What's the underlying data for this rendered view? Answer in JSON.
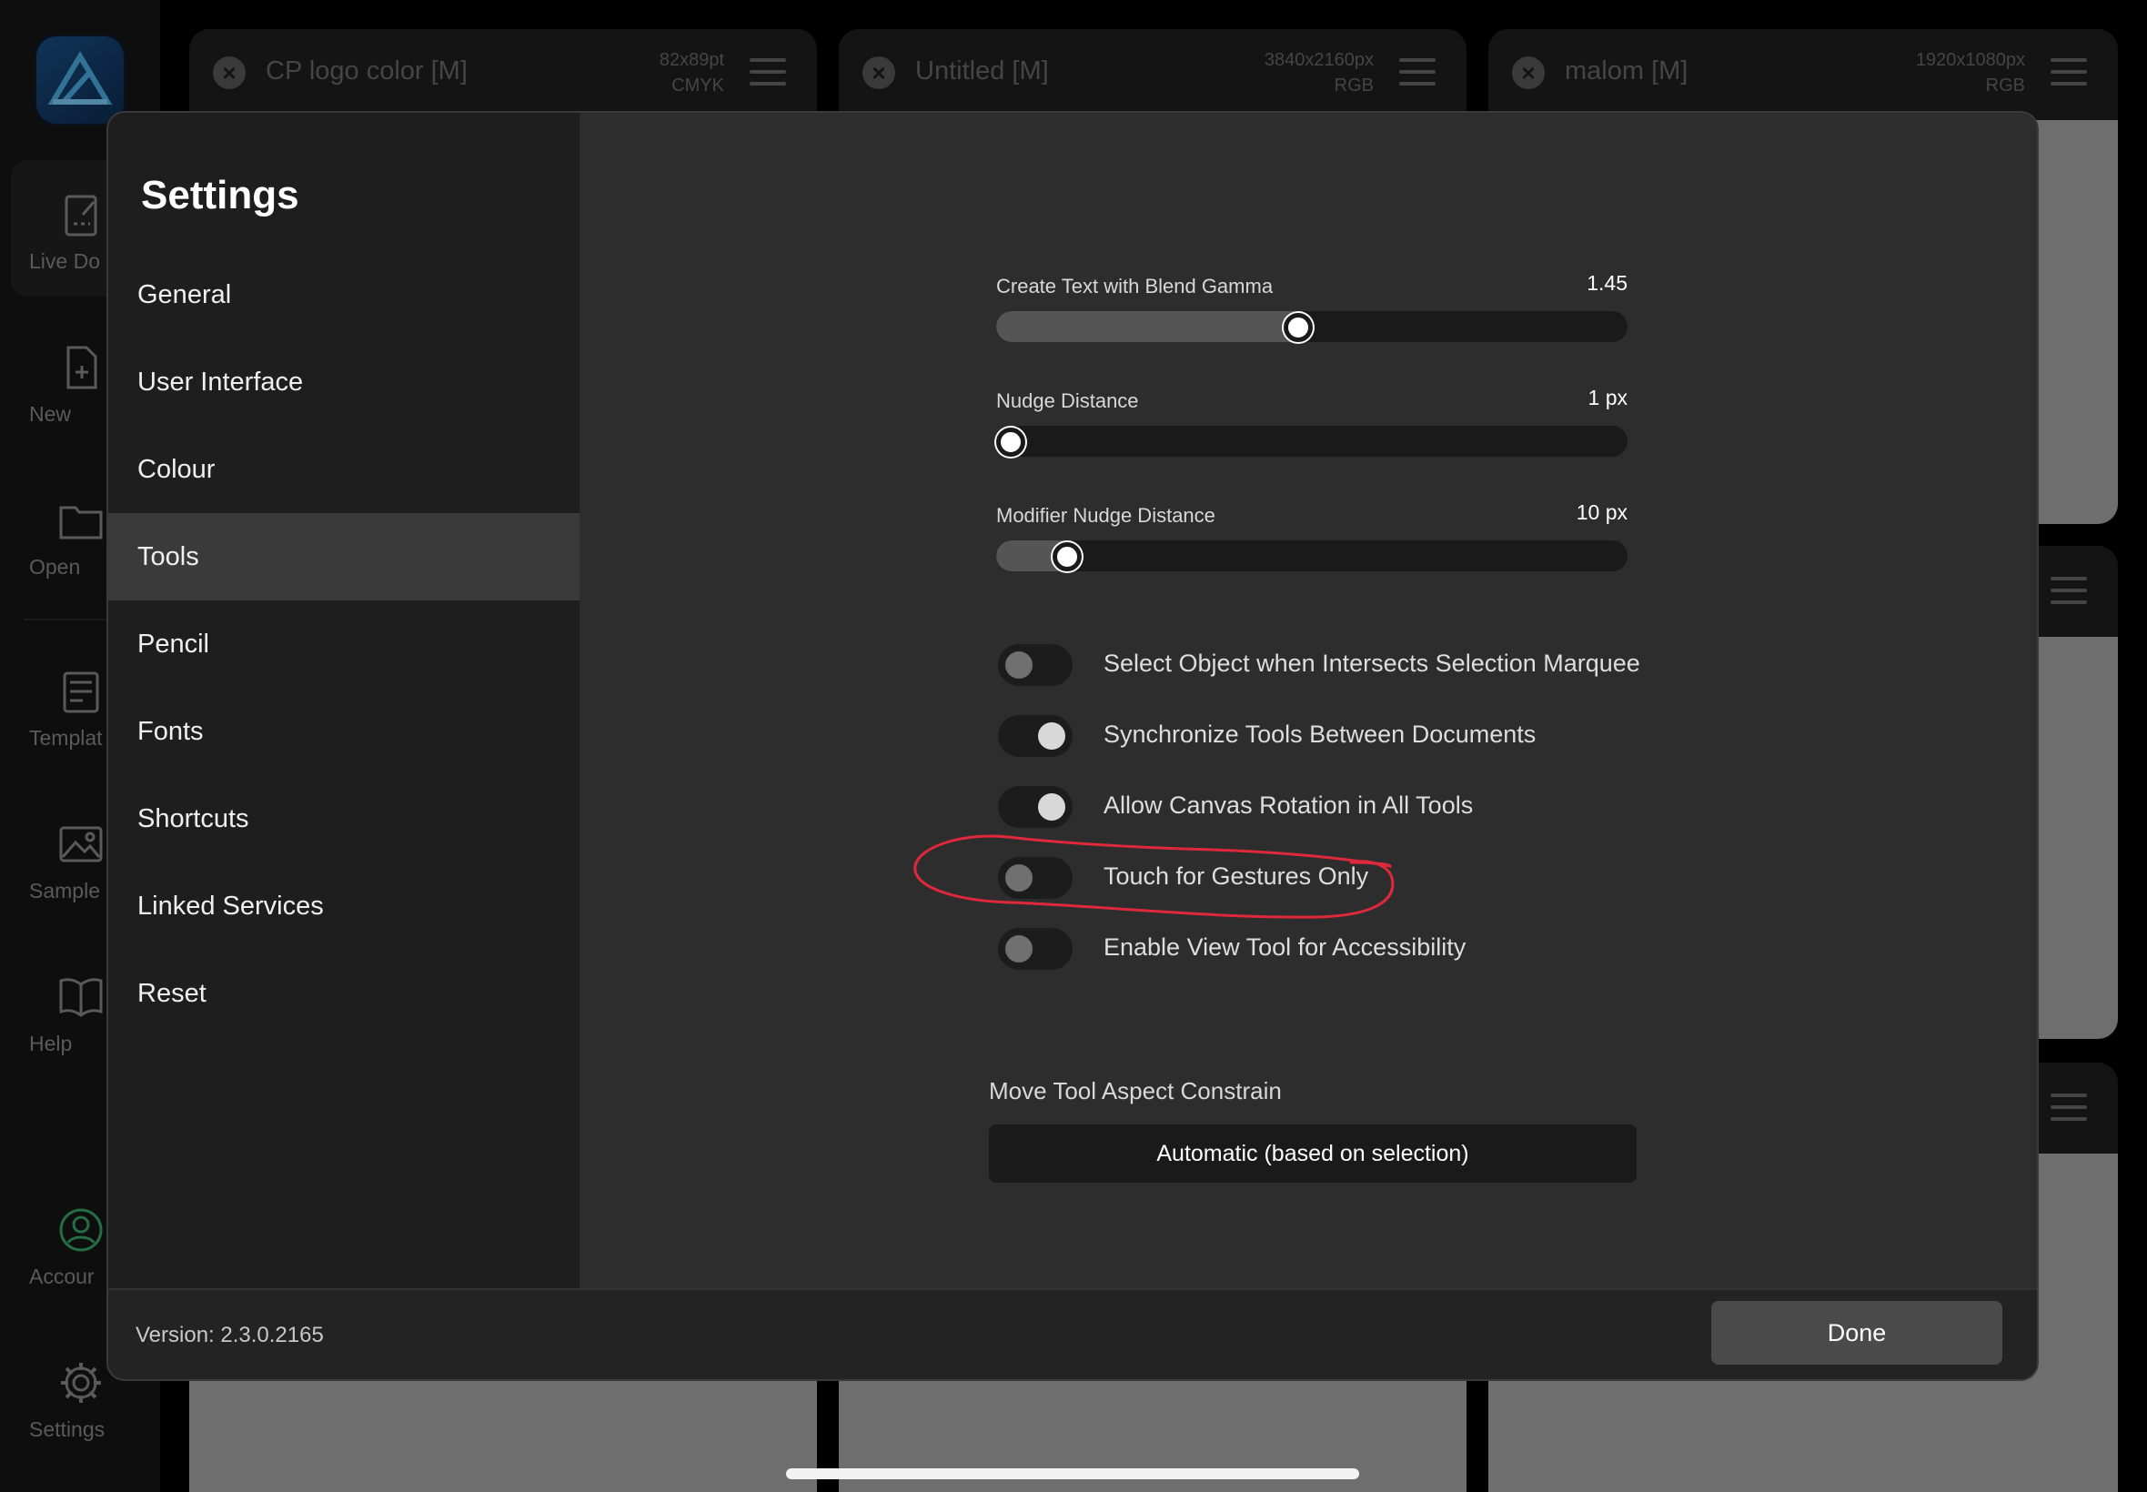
{
  "app_sidebar": {
    "items": [
      {
        "label": "Live Do",
        "icon": "live-document-icon"
      },
      {
        "label": "New",
        "icon": "new-document-icon"
      },
      {
        "label": "Open",
        "icon": "folder-icon"
      },
      {
        "label": "Templat",
        "icon": "template-icon"
      },
      {
        "label": "Sample",
        "icon": "image-icon"
      },
      {
        "label": "Help",
        "icon": "book-icon"
      },
      {
        "label": "Accour",
        "icon": "account-icon"
      },
      {
        "label": "Settings",
        "icon": "gear-icon"
      }
    ]
  },
  "documents": [
    {
      "title": "CP logo color [M]",
      "size": "82x89pt",
      "mode": "CMYK"
    },
    {
      "title": "Untitled [M]",
      "size": "3840x2160px",
      "mode": "RGB"
    },
    {
      "title": "malom [M]",
      "size": "1920x1080px",
      "mode": "RGB"
    }
  ],
  "settings": {
    "title": "Settings",
    "nav": [
      "General",
      "User Interface",
      "Colour",
      "Tools",
      "Pencil",
      "Fonts",
      "Shortcuts",
      "Linked Services",
      "Reset"
    ],
    "selected": "Tools",
    "sliders": [
      {
        "label": "Create Text with Blend Gamma",
        "value": "1.45",
        "fraction": 0.485
      },
      {
        "label": "Nudge Distance",
        "value": "1 px",
        "fraction": 0.03
      },
      {
        "label": "Modifier Nudge Distance",
        "value": "10 px",
        "fraction": 0.12
      }
    ],
    "toggles": [
      {
        "label": "Select Object when Intersects Selection Marquee",
        "on": false
      },
      {
        "label": "Synchronize Tools Between Documents",
        "on": true
      },
      {
        "label": "Allow Canvas Rotation in All Tools",
        "on": true
      },
      {
        "label": "Touch for Gestures Only",
        "on": false
      },
      {
        "label": "Enable View Tool for Accessibility",
        "on": false
      }
    ],
    "constrain": {
      "label": "Move Tool Aspect Constrain",
      "value": "Automatic (based on selection)"
    },
    "version": "Version: 2.3.0.2165",
    "done_label": "Done"
  },
  "colors": {
    "annotation": "#e0283c",
    "dialog_bg": "#2c2c2c",
    "nav_bg": "#1e1e1e"
  }
}
